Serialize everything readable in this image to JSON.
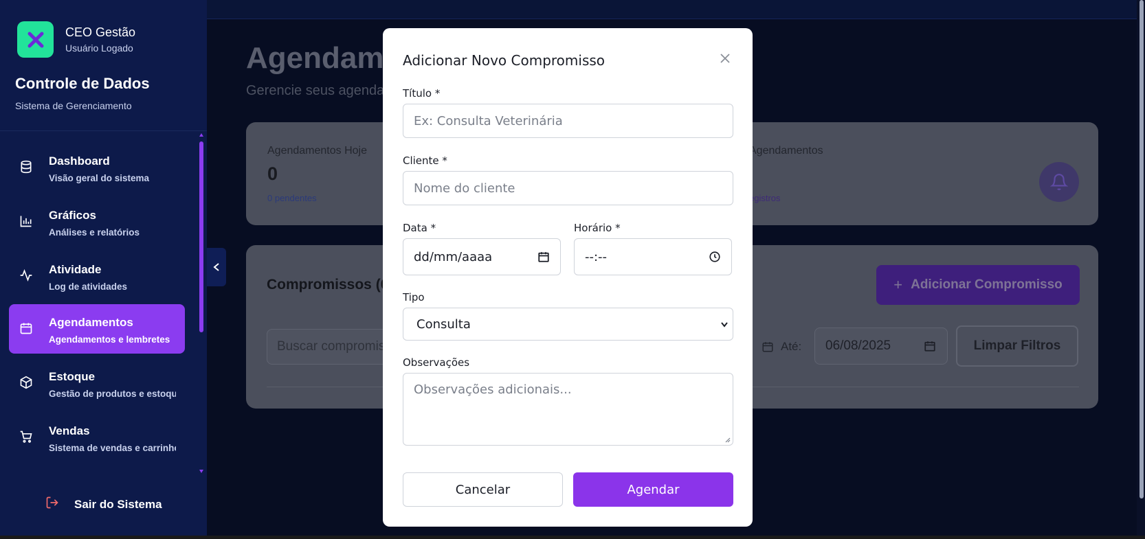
{
  "brand": {
    "name": "CEO Gestão",
    "user": "Usuário Logado"
  },
  "app": {
    "title": "Controle de Dados",
    "subtitle": "Sistema de Gerenciamento"
  },
  "nav": [
    {
      "label": "Dashboard",
      "desc": "Visão geral do sistema",
      "icon": "database-icon"
    },
    {
      "label": "Gráficos",
      "desc": "Análises e relatórios",
      "icon": "bar-chart-icon"
    },
    {
      "label": "Atividade",
      "desc": "Log de atividades",
      "icon": "activity-icon"
    },
    {
      "label": "Agendamentos",
      "desc": "Agendamentos e lembretes",
      "icon": "calendar-icon",
      "active": true
    },
    {
      "label": "Estoque",
      "desc": "Gestão de produtos e estoque",
      "icon": "package-icon"
    },
    {
      "label": "Vendas",
      "desc": "Sistema de vendas e carrinho",
      "icon": "cart-icon"
    }
  ],
  "logout": {
    "label": "Sair do Sistema"
  },
  "page": {
    "title": "Agendamentos",
    "subtitle": "Gerencie seus agendamentos"
  },
  "stats": {
    "today_label": "Agendamentos Hoje",
    "today_value": "0",
    "today_hint": "0 pendentes",
    "total_label": "Agendamentos",
    "total_hint": "egistros"
  },
  "list": {
    "title": "Compromissos (0",
    "add_button": "Adicionar Compromisso",
    "search_placeholder": "Buscar compromis",
    "until_label": "Até:",
    "until_value": "06/08/2025",
    "clear_button": "Limpar Filtros"
  },
  "modal": {
    "title": "Adicionar Novo Compromisso",
    "titulo_label": "Título *",
    "titulo_placeholder": "Ex: Consulta Veterinária",
    "cliente_label": "Cliente *",
    "cliente_placeholder": "Nome do cliente",
    "data_label": "Data *",
    "data_placeholder": "dd/mm/aaaa",
    "horario_label": "Horário *",
    "horario_placeholder": "--:--",
    "tipo_label": "Tipo",
    "tipo_value": "Consulta",
    "obs_label": "Observações",
    "obs_placeholder": "Observações adicionais...",
    "cancel_button": "Cancelar",
    "submit_button": "Agendar"
  },
  "colors": {
    "accent": "#8b34ea",
    "brand_logo": "#22e39a",
    "sidebar": "#0d1a4a"
  }
}
